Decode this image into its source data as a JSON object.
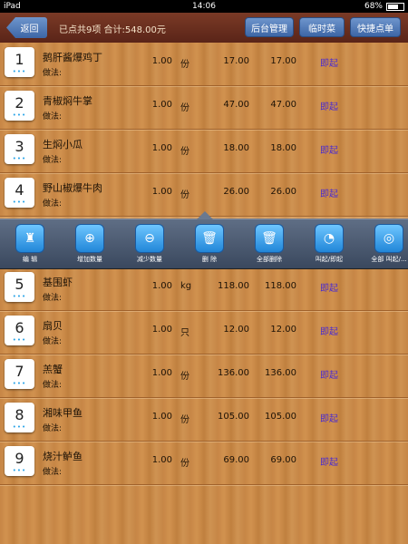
{
  "status": {
    "carrier": "iPad",
    "time": "14:06",
    "battery": "68%",
    "battery_level": 0.68
  },
  "toolbar": {
    "back_label": "返回",
    "summary": "已点共9项 合计:548.00元",
    "buttons": [
      "后台管理",
      "临时菜",
      "快捷点单"
    ]
  },
  "method_label": "做法:",
  "action_label": "即起",
  "dots": "•••",
  "orders": [
    {
      "index": "1",
      "name": "鹅肝酱爆鸡丁",
      "qty": "1.00",
      "unit": "份",
      "price": "17.00",
      "total": "17.00"
    },
    {
      "index": "2",
      "name": "青椒焖牛掌",
      "qty": "1.00",
      "unit": "份",
      "price": "47.00",
      "total": "47.00"
    },
    {
      "index": "3",
      "name": "生焖小瓜",
      "qty": "1.00",
      "unit": "份",
      "price": "18.00",
      "total": "18.00"
    },
    {
      "index": "4",
      "name": "野山椒爆牛肉",
      "qty": "1.00",
      "unit": "份",
      "price": "26.00",
      "total": "26.00"
    },
    {
      "index": "5",
      "name": "基围虾",
      "qty": "1.00",
      "unit": "kg",
      "price": "118.00",
      "total": "118.00"
    },
    {
      "index": "6",
      "name": "扇贝",
      "qty": "1.00",
      "unit": "只",
      "price": "12.00",
      "total": "12.00"
    },
    {
      "index": "7",
      "name": "羔蟹",
      "qty": "1.00",
      "unit": "份",
      "price": "136.00",
      "total": "136.00"
    },
    {
      "index": "8",
      "name": "湘味甲鱼",
      "qty": "1.00",
      "unit": "份",
      "price": "105.00",
      "total": "105.00"
    },
    {
      "index": "9",
      "name": "烧汁鲈鱼",
      "qty": "1.00",
      "unit": "份",
      "price": "69.00",
      "total": "69.00"
    }
  ],
  "operations": [
    {
      "label": "编 辑",
      "icon": "bottle-icon",
      "glyph": "♜"
    },
    {
      "label": "增加数量",
      "icon": "plus-icon",
      "glyph": "⊕"
    },
    {
      "label": "减少数量",
      "icon": "minus-icon",
      "glyph": "⊖"
    },
    {
      "label": "删 除",
      "icon": "trash-icon",
      "glyph": "🗑"
    },
    {
      "label": "全部删除",
      "icon": "trash-all-icon",
      "glyph": "🗑"
    },
    {
      "label": "叫起/即起",
      "icon": "clock-icon",
      "glyph": "◔"
    },
    {
      "label": "全部 叫起/...",
      "icon": "clock-all-icon",
      "glyph": "◎"
    }
  ],
  "colors": {
    "toolbar": "#5a2418",
    "button": "#3d66a6",
    "action_text": "#4a2bd0",
    "dots": "#2aa4e8"
  }
}
